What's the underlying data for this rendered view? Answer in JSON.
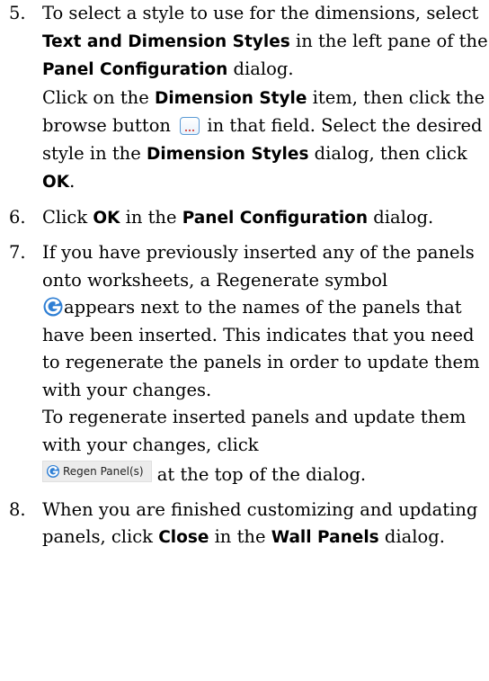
{
  "steps": [
    {
      "number": "5.",
      "t1": "To select a style to use for the dimensions, select ",
      "b1": "Text and Dimension Styles",
      "t2": " in the left pane of the ",
      "b2": "Panel Configuration",
      "t3": " dialog.",
      "t4": "Click on the ",
      "b3": "Dimension Style",
      "t5": " item, then click the browse button ",
      "t6": " in that field. Select the desired style in the ",
      "b4": "Dimension Styles",
      "t7": " dialog, then click ",
      "b5": "OK",
      "t8": "."
    },
    {
      "number": "6.",
      "t1": "Click ",
      "b1": "OK",
      "t2": " in the ",
      "b2": "Panel Configuration",
      "t3": " dialog."
    },
    {
      "number": "7.",
      "t1": "If you have previously inserted any of the panels onto worksheets, a Regenerate symbol",
      "t2": "appears next to the names of the panels that have been inserted. This indicates that you need to regenerate the panels in order to update them with your changes.",
      "t3": "To regenerate inserted panels and update them with your changes, click",
      "button_label": "Regen Panel(s)",
      "t4": " at the top of the dialog."
    },
    {
      "number": "8.",
      "t1": "When you are finished customizing and updating panels, click ",
      "b1": "Close",
      "t2": " in the ",
      "b2": "Wall Panels",
      "t3": " dialog."
    }
  ],
  "icons": {
    "browse": "browse-button-icon",
    "regenerate": "regenerate-icon",
    "regenerate_color": "#2f7fd4"
  }
}
